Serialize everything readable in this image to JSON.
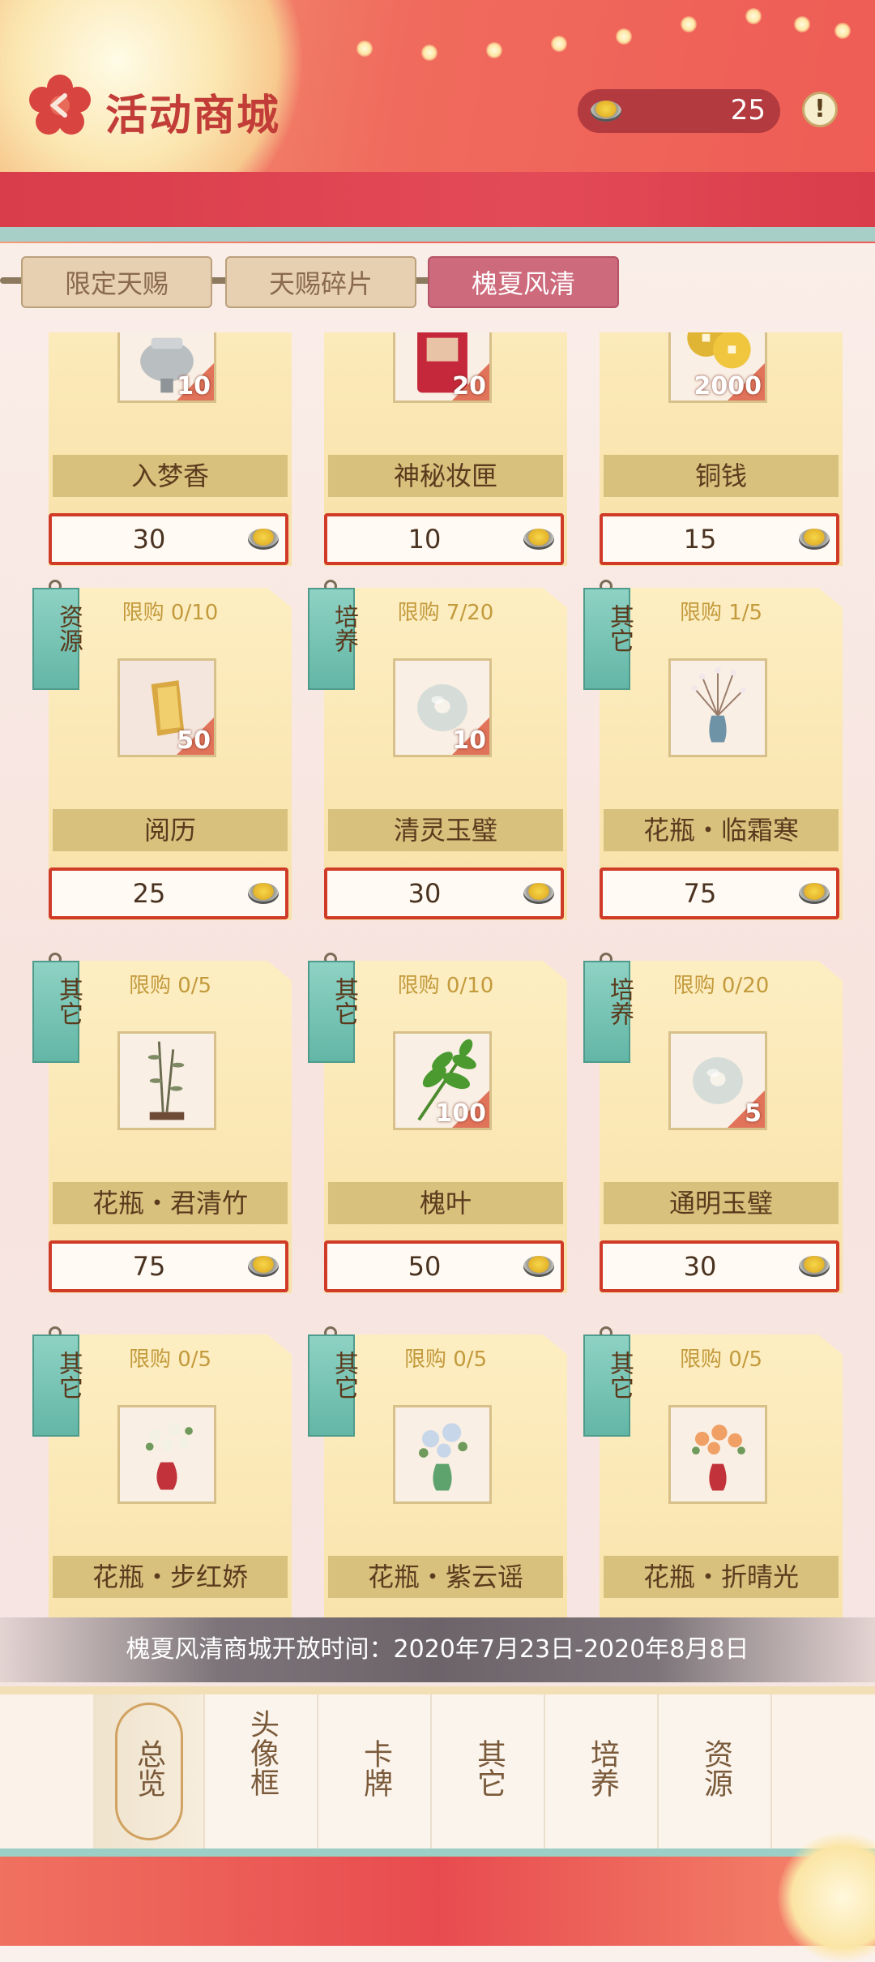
{
  "header": {
    "title": "活动商城",
    "currency_amount": "25",
    "info_label": "!"
  },
  "tabs": [
    {
      "label": "限定天赐",
      "active": false
    },
    {
      "label": "天赐碎片",
      "active": false
    },
    {
      "label": "槐夏风清",
      "active": true
    }
  ],
  "items": [
    {
      "limit": "",
      "category": "",
      "name": "入梦香",
      "quantity": "10",
      "price": "30",
      "icon": "incense-burner-icon"
    },
    {
      "limit": "",
      "category": "",
      "name": "神秘妆匣",
      "quantity": "20",
      "price": "10",
      "icon": "gift-box-icon"
    },
    {
      "limit": "",
      "category": "",
      "name": "铜钱",
      "quantity": "2000",
      "price": "15",
      "icon": "copper-coins-icon"
    },
    {
      "limit": "限购 0/10",
      "category": "资源",
      "name": "阅历",
      "quantity": "50",
      "price": "25",
      "icon": "experience-scroll-icon"
    },
    {
      "limit": "限购 7/20",
      "category": "培养",
      "name": "清灵玉璧",
      "quantity": "10",
      "price": "30",
      "icon": "jade-disc-icon"
    },
    {
      "limit": "限购 1/5",
      "category": "其它",
      "name": "花瓶・临霜寒",
      "quantity": "",
      "price": "75",
      "icon": "vase-plum-icon"
    },
    {
      "limit": "限购 0/5",
      "category": "其它",
      "name": "花瓶・君清竹",
      "quantity": "",
      "price": "75",
      "icon": "vase-bamboo-icon"
    },
    {
      "limit": "限购 0/10",
      "category": "其它",
      "name": "槐叶",
      "quantity": "100",
      "price": "50",
      "icon": "leaf-icon"
    },
    {
      "limit": "限购 0/20",
      "category": "培养",
      "name": "通明玉璧",
      "quantity": "5",
      "price": "30",
      "icon": "jade-disc-icon"
    },
    {
      "limit": "限购 0/5",
      "category": "其它",
      "name": "花瓶・步红娇",
      "quantity": "",
      "price": "",
      "icon": "vase-red-icon"
    },
    {
      "limit": "限购 0/5",
      "category": "其它",
      "name": "花瓶・紫云谣",
      "quantity": "",
      "price": "",
      "icon": "vase-green-icon"
    },
    {
      "limit": "限购 0/5",
      "category": "其它",
      "name": "花瓶・折晴光",
      "quantity": "",
      "price": "",
      "icon": "vase-orange-icon"
    }
  ],
  "banner": {
    "text": "槐夏风清商城开放时间：2020年7月23日-2020年8月8日"
  },
  "bottom_nav": [
    {
      "label": "总览",
      "active": true
    },
    {
      "label": "头像框",
      "active": false
    },
    {
      "label": "卡牌",
      "active": false
    },
    {
      "label": "其它",
      "active": false
    },
    {
      "label": "培养",
      "active": false
    },
    {
      "label": "资源",
      "active": false
    }
  ],
  "colors": {
    "header_red": "#ee5c55",
    "active_tab": "#cd6a7c",
    "price_border": "#cf3b27",
    "tag_teal": "#63b6a6"
  }
}
